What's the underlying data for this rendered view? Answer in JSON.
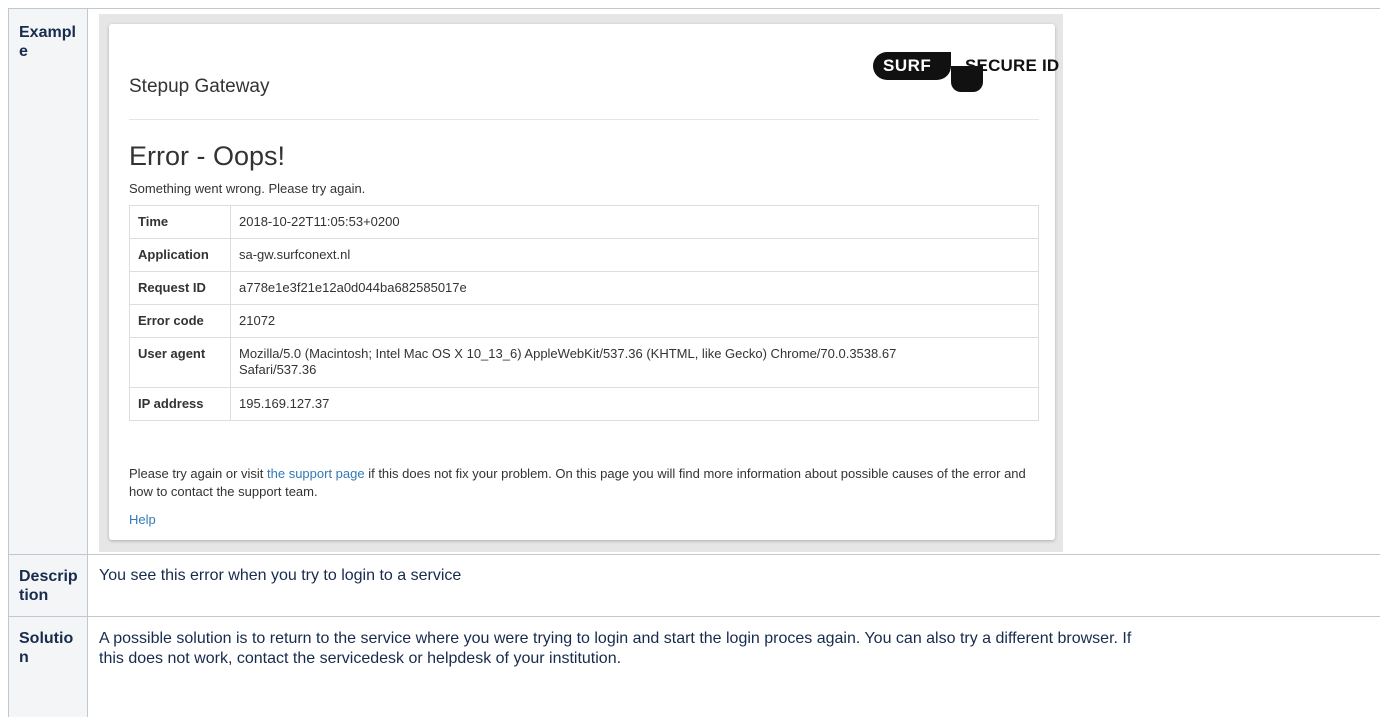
{
  "rows": {
    "example": {
      "label": "Example"
    },
    "description": {
      "label": "Description",
      "text": "You see this error when you try to login to a service"
    },
    "solution": {
      "label": "Solution",
      "text": "A possible solution is to return to the service where you were trying to login and start the login proces again. You can also try a different browser. If this does not work, contact the servicedesk or helpdesk of your institution."
    }
  },
  "screenshot": {
    "gateway_title": "Stepup Gateway",
    "logo": {
      "surf": "SURF",
      "secure": "SECURE ID"
    },
    "error_title": "Error - Oops!",
    "error_subtitle": "Something went wrong. Please try again.",
    "info_rows": [
      {
        "key": "Time",
        "value": "2018-10-22T11:05:53+0200"
      },
      {
        "key": "Application",
        "value": "sa-gw.surfconext.nl"
      },
      {
        "key": "Request ID",
        "value": "a778e1e3f21e12a0d044ba682585017e"
      },
      {
        "key": "Error code",
        "value": "21072"
      },
      {
        "key": "User agent",
        "value": "Mozilla/5.0 (Macintosh; Intel Mac OS X 10_13_6) AppleWebKit/537.36 (KHTML, like Gecko) Chrome/70.0.3538.67 Safari/537.36"
      },
      {
        "key": "IP address",
        "value": "195.169.127.37"
      }
    ],
    "footer_before": "Please try again or visit ",
    "footer_link": "the support page",
    "footer_after": " if this does not fix your problem. On this page you will find more information about possible causes of the error and how to contact the support team.",
    "help_link": "Help"
  },
  "colors": {
    "link": "#337ab7",
    "header_bg": "#f4f5f7",
    "border": "#c1c7d0"
  }
}
